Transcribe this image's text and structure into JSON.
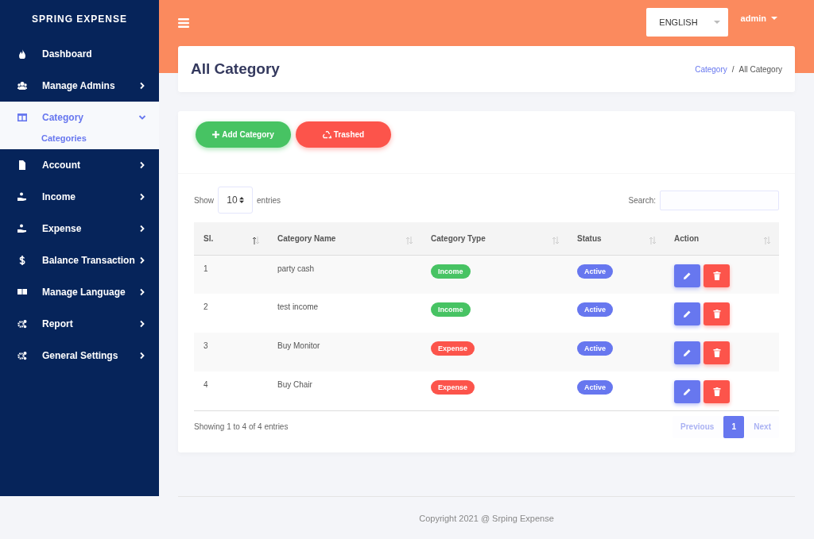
{
  "sidebar": {
    "brand": "SPRING EXPENSE",
    "items": [
      {
        "label": "Dashboard",
        "has_submenu": false,
        "expanded": false,
        "selected": false
      },
      {
        "label": "Manage Admins",
        "has_submenu": true,
        "expanded": false,
        "selected": false
      },
      {
        "label": "Category",
        "has_submenu": true,
        "expanded": true,
        "selected": true,
        "children": [
          {
            "label": "Categories",
            "selected": true
          }
        ]
      },
      {
        "label": "Account",
        "has_submenu": true,
        "expanded": false,
        "selected": false
      },
      {
        "label": "Income",
        "has_submenu": true,
        "expanded": false,
        "selected": false
      },
      {
        "label": "Expense",
        "has_submenu": true,
        "expanded": false,
        "selected": false
      },
      {
        "label": "Balance Transaction",
        "has_submenu": true,
        "expanded": false,
        "selected": false
      },
      {
        "label": "Manage Language",
        "has_submenu": true,
        "expanded": false,
        "selected": false
      },
      {
        "label": "Report",
        "has_submenu": true,
        "expanded": false,
        "selected": false
      },
      {
        "label": "General Settings",
        "has_submenu": true,
        "expanded": false,
        "selected": false
      }
    ]
  },
  "topbar": {
    "language": "ENGLISH",
    "user": "admin"
  },
  "page_header": {
    "title": "All Category",
    "breadcrumb_separator": "/",
    "breadcrumb": [
      {
        "label": "Category",
        "link": true
      },
      {
        "label": "All Category",
        "link": false
      }
    ]
  },
  "actions": [
    {
      "label": "Add Category",
      "kind": "add"
    },
    {
      "label": "Trashed",
      "kind": "trash"
    }
  ],
  "table_controls": {
    "show_label": "Show",
    "page_size": "10",
    "entries_label": "entries",
    "search_label": "Search:"
  },
  "table": {
    "columns": [
      {
        "label": "Sl.",
        "sorted": true
      },
      {
        "label": "Category Name",
        "sorted": false
      },
      {
        "label": "Category Type",
        "sorted": false
      },
      {
        "label": "Status",
        "sorted": false
      },
      {
        "label": "Action",
        "sorted": false
      }
    ],
    "rows": [
      {
        "sl": "1",
        "name": "party cash",
        "type": {
          "label": "Income",
          "kind": "income"
        },
        "status": {
          "label": "Active",
          "kind": "active"
        }
      },
      {
        "sl": "2",
        "name": "test income",
        "type": {
          "label": "Income",
          "kind": "income"
        },
        "status": {
          "label": "Active",
          "kind": "active"
        }
      },
      {
        "sl": "3",
        "name": "Buy Monitor",
        "type": {
          "label": "Expense",
          "kind": "expense"
        },
        "status": {
          "label": "Active",
          "kind": "active"
        }
      },
      {
        "sl": "4",
        "name": "Buy Chair",
        "type": {
          "label": "Expense",
          "kind": "expense"
        },
        "status": {
          "label": "Active",
          "kind": "active"
        }
      }
    ]
  },
  "table_footer": {
    "info": "Showing 1 to 4 of 4 entries",
    "pagination": [
      {
        "label": "Previous",
        "disabled": true,
        "selected": false
      },
      {
        "label": "1",
        "disabled": false,
        "selected": true
      },
      {
        "label": "Next",
        "disabled": true,
        "selected": false
      }
    ]
  },
  "footer": {
    "text": "Copyright 2021 @ Srping Expense"
  }
}
